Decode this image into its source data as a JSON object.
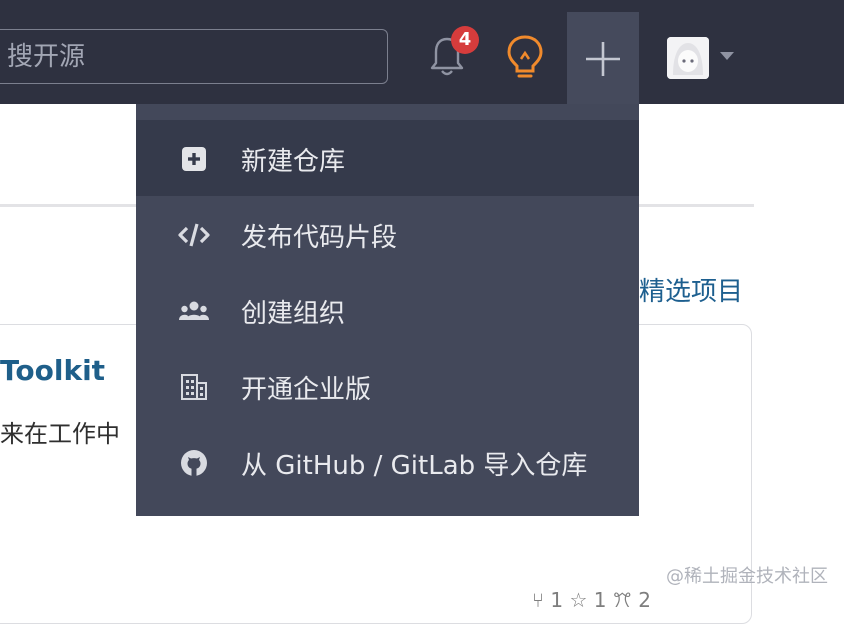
{
  "header": {
    "search_placeholder": "搜开源",
    "notification_count": "4"
  },
  "page": {
    "featured_link": "精选项目",
    "card": {
      "title": "Toolkit",
      "description": "来在工作中",
      "stats": "⑂ 1  ☆ 1  ꔫ 2"
    },
    "watermark": "@稀土掘金技术社区"
  },
  "dropdown": {
    "items": [
      {
        "label": "新建仓库",
        "icon": "plus-square-icon"
      },
      {
        "label": "发布代码片段",
        "icon": "code-icon"
      },
      {
        "label": "创建组织",
        "icon": "users-icon"
      },
      {
        "label": "开通企业版",
        "icon": "building-icon"
      },
      {
        "label": "从 GitHub / GitLab 导入仓库",
        "icon": "github-icon"
      }
    ]
  },
  "colors": {
    "topbar": "#2e3140",
    "dropdown": "#43485a",
    "dropdown_active": "#353a4b",
    "badge": "#d63c3c",
    "bulb": "#f08a2c",
    "link": "#1d5f8f"
  }
}
